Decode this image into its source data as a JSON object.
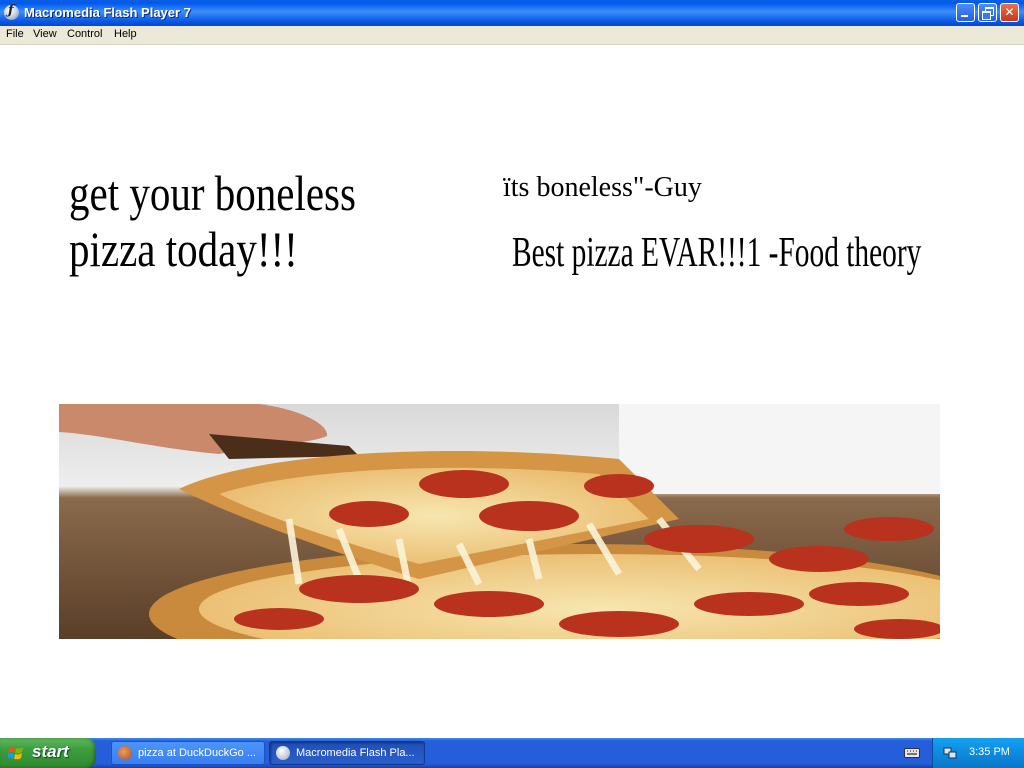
{
  "window": {
    "title": "Macromedia Flash Player 7",
    "controls": {
      "minimize": "minimize",
      "restore": "restore",
      "close": "close"
    }
  },
  "menu": {
    "items": [
      {
        "label": "File"
      },
      {
        "label": "View"
      },
      {
        "label": "Control"
      },
      {
        "label": "Help"
      }
    ]
  },
  "content": {
    "headline_line1": "get your boneless",
    "headline_line2": "pizza today!!!",
    "quote1": "ïts boneless\"-Guy",
    "quote2": "Best pizza EVAR!!!1 -Food theory",
    "image": "pepperoni-pizza-slice-photo"
  },
  "taskbar": {
    "start_label": "start",
    "tasks": [
      {
        "label": "pizza at DuckDuckGo ...",
        "icon": "duckduckgo-icon",
        "active": false
      },
      {
        "label": "Macromedia Flash Pla...",
        "icon": "flash-icon",
        "active": true
      }
    ],
    "tray": {
      "time": "3:35 PM",
      "icons": [
        "keyboard-icon",
        "network-icon"
      ]
    }
  },
  "colors": {
    "titlebar": "#0a5be8",
    "menubar": "#ece9d8",
    "taskbar": "#245edb",
    "start_button": "#3c9c3c",
    "tray": "#0d8be0"
  }
}
